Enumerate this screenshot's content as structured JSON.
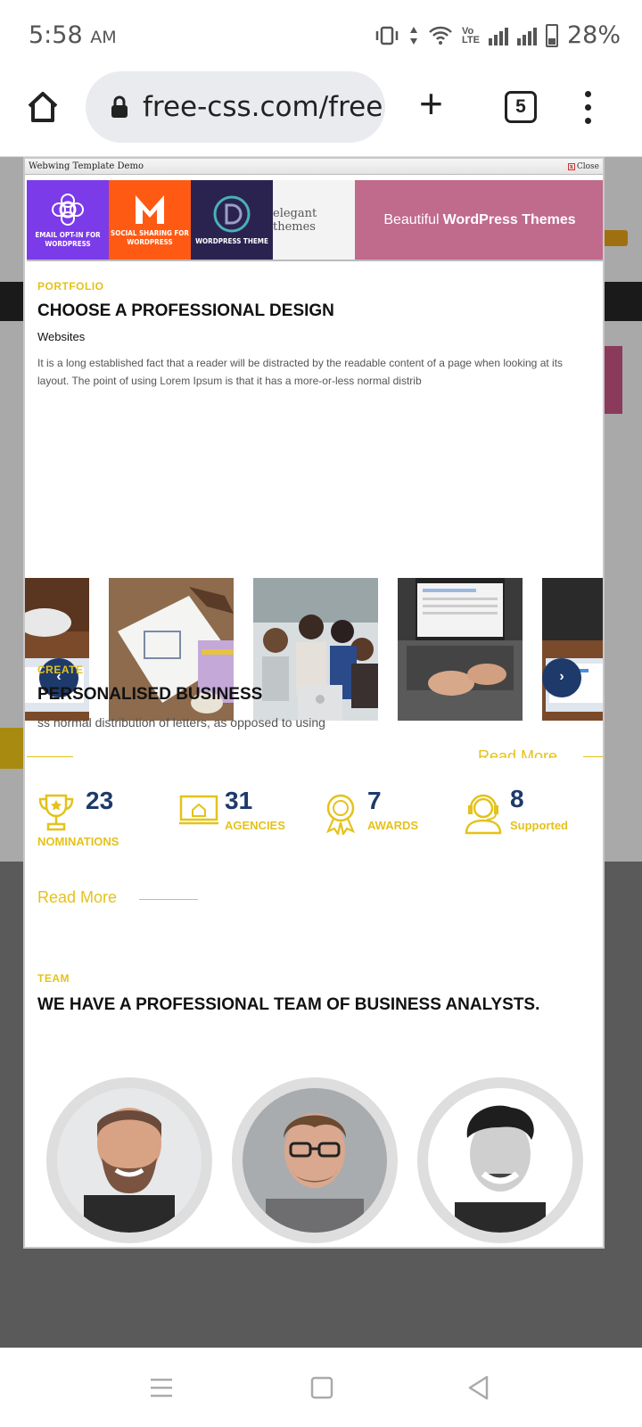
{
  "status": {
    "time": "5:58",
    "ampm": "AM",
    "battery": "28%"
  },
  "browser": {
    "url": "free-css.com/free",
    "tab_count": "5"
  },
  "modal": {
    "title": "Webwing Template Demo",
    "close": "Close",
    "banner": {
      "tiles": [
        {
          "caption": "EMAIL OPT-IN FOR WORDPRESS",
          "color": "#7b3be8"
        },
        {
          "caption": "SOCIAL SHARING FOR WORDPRESS",
          "color": "#ff5a14"
        },
        {
          "caption": "WORDPRESS THEME",
          "color": "#2a2350"
        },
        {
          "caption": "elegant themes",
          "color": "#f3f3f3"
        }
      ],
      "cta_light": "Beautiful",
      "cta_bold": "WordPress Themes"
    },
    "portfolio": {
      "eyebrow": "PORTFOLIO",
      "heading": "CHOOSE A PROFESSIONAL DESIGN",
      "subhead": "Websites",
      "paragraph": "It is a long established fact that a reader will be distracted by the readable content of a page when looking at its layout. The point of using Lorem Ipsum is that it has a more-or-less normal distrib",
      "read_more": "Read More"
    },
    "business": {
      "eyebrow": "CREATE",
      "heading": "PERSONALISED BUSINESS",
      "paragraph": "ss normal distribution of letters, as opposed to using",
      "read_more": "Read More",
      "stats": [
        {
          "value": "23",
          "label": "NOMINATIONS",
          "icon": "trophy-icon"
        },
        {
          "value": "31",
          "label": "AGENCIES",
          "icon": "monitor-home-icon"
        },
        {
          "value": "7",
          "label": "AWARDS",
          "icon": "award-badge-icon"
        },
        {
          "value": "8",
          "label": "Supported",
          "icon": "support-headset-icon"
        }
      ]
    },
    "team": {
      "eyebrow": "TEAM",
      "heading": "WE HAVE A PROFESSIONAL TEAM OF BUSINESS ANALYSTS."
    }
  },
  "colors": {
    "accent": "#e4c21b",
    "navy": "#1e3a6b",
    "overlay": "#5a5a5a"
  }
}
